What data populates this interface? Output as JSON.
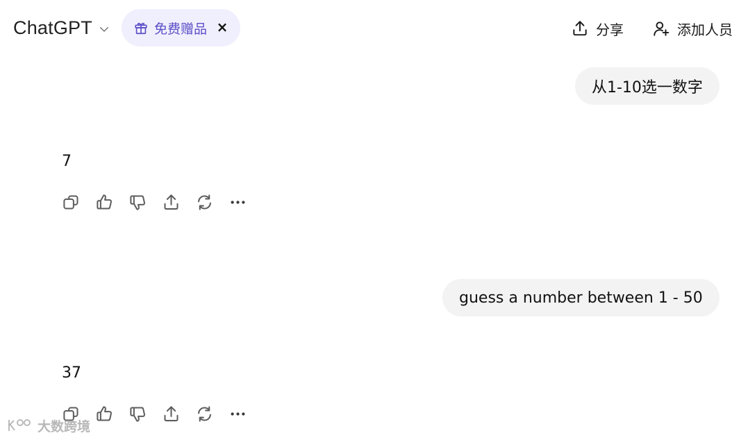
{
  "header": {
    "model_name": "ChatGPT",
    "promo_label": "免费赠品",
    "promo_close": "×",
    "share_label": "分享",
    "add_people_label": "添加人员"
  },
  "conversation": [
    {
      "role": "user",
      "text": "从1-10选一数字"
    },
    {
      "role": "assistant",
      "text": "7"
    },
    {
      "role": "user",
      "text": "guess a number between 1 - 50"
    },
    {
      "role": "assistant",
      "text": "37"
    }
  ],
  "message_actions": [
    "copy-icon",
    "thumbs-up-icon",
    "thumbs-down-icon",
    "share-icon",
    "regenerate-icon",
    "more-icon"
  ],
  "watermark": {
    "text": "大数跨境"
  },
  "colors": {
    "promo_bg": "#f0effd",
    "promo_text": "#5b4fc7",
    "user_bubble_bg": "#f3f3f3"
  }
}
